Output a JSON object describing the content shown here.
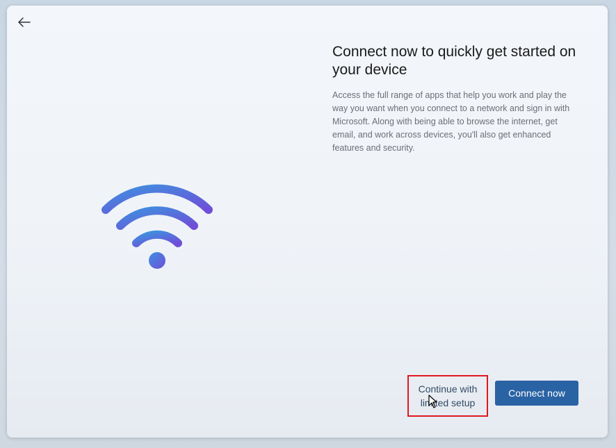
{
  "header": {
    "back_icon": "arrow-left-icon"
  },
  "illustration": {
    "icon": "wifi-icon",
    "colors": [
      "#3f8fdf",
      "#6f4fd8"
    ]
  },
  "main": {
    "title": "Connect now to quickly get started on your device",
    "description": "Access the full range of apps that help you work and play the way you want when you connect to a network and sign in with Microsoft. Along with being able to browse the internet, get email, and work across devices, you'll also get enhanced features and security."
  },
  "footer": {
    "limited_setup_label": "Continue with limited setup",
    "connect_now_label": "Connect now",
    "connect_now_color": "#2a63a4",
    "highlight_color": "#e0171f"
  },
  "cursor": {
    "icon": "mouse-pointer-icon"
  }
}
